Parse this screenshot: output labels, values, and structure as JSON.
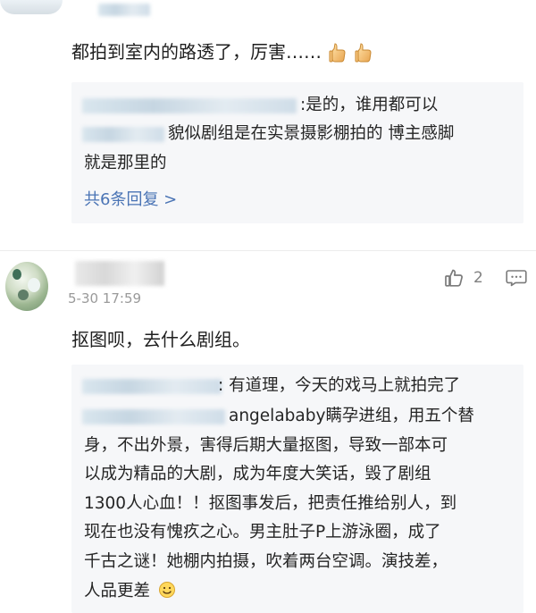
{
  "first_comment": {
    "text": "都拍到室内的路透了，厉害……",
    "icons": [
      "thumbs-up-icon",
      "thumbs-up-icon"
    ],
    "replies": [
      {
        "lines": [
          ":是的，谁用都可以",
          "貌似剧组是在实景摄影棚拍的 博主感脚",
          "就是那里的"
        ]
      }
    ],
    "more_replies": "共6条回复 >"
  },
  "second_comment": {
    "timestamp": "5-30 17:59",
    "likes": "2",
    "text": "抠图呗，去什么剧组。",
    "reply": {
      "lines": [
        ": 有道理，今天的戏马上就拍完了",
        "angelababy瞒孕进组，用五个替",
        "身，不出外景，害得后期大量抠图，导致一部本可",
        "以成为精品的大剧，成为年度大笑话，毁了剧组",
        "1300人心血！！抠图事发后，把责任推给别人，到",
        "现在也没有愧疚之心。男主肚子P上游泳圈，成了",
        "千古之谜！她棚内拍摄，吹着两台空调。演技差，",
        "人品更差"
      ],
      "end_emoji": "smiley-icon"
    }
  },
  "colors": {
    "link_blue": "#4a74b5",
    "reply_bg": "#f6f7f9",
    "timestamp_gray": "#9a9a9a"
  }
}
